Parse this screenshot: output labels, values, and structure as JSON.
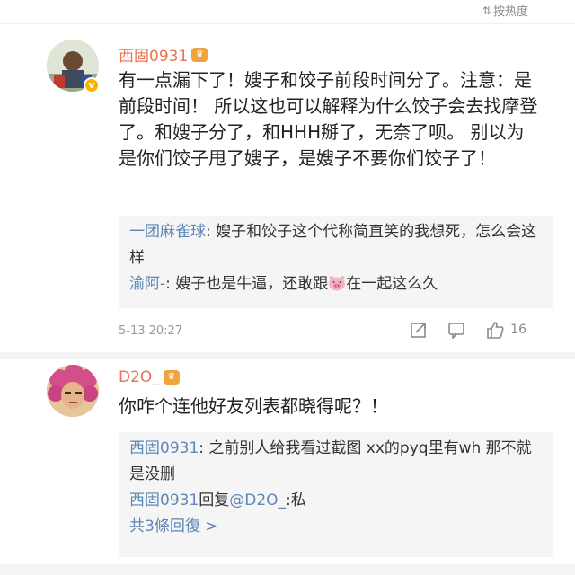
{
  "sort": {
    "label": "按热度",
    "icon": "sort-icon"
  },
  "comments": [
    {
      "username": "西固0931",
      "badge": "crown-icon",
      "verified_icon": "v",
      "text": "有一点漏下了！嫂子和饺子前段时间分了。注意：是前段时间！ 所以这也可以解释为什么饺子会去找摩登了。和嫂子分了，和HHH掰了，无奈了呗。 别以为是你们饺子甩了嫂子，是嫂子不要你们饺子了！",
      "replies": [
        {
          "user": "一团麻雀球",
          "sep": ":",
          "text": " 嫂子和饺子这个代称简直笑的我想死，怎么会这样"
        },
        {
          "user": "渝阿-",
          "sep": ":",
          "text_before": " 嫂子也是牛逼，还敢跟",
          "text_after": "在一起这么久"
        }
      ],
      "time": "5-13 20:27",
      "like_count": "16"
    },
    {
      "username": "D2O_",
      "badge": "crown-icon",
      "text": "你咋个连他好友列表都晓得呢？！",
      "replies": [
        {
          "user": "西固0931",
          "sep": ":",
          "text": " 之前别人给我看过截图 xx的pyq里有wh 那不就是没删"
        },
        {
          "user": "西固0931",
          "reply_label": "回复",
          "target": "@D2O_",
          "sep": ":",
          "text": "私"
        }
      ],
      "more_replies": "共3條回復 >"
    }
  ],
  "colors": {
    "username": "#eb7350",
    "reply_user": "#5f86b6",
    "meta": "#9a9a9a"
  }
}
